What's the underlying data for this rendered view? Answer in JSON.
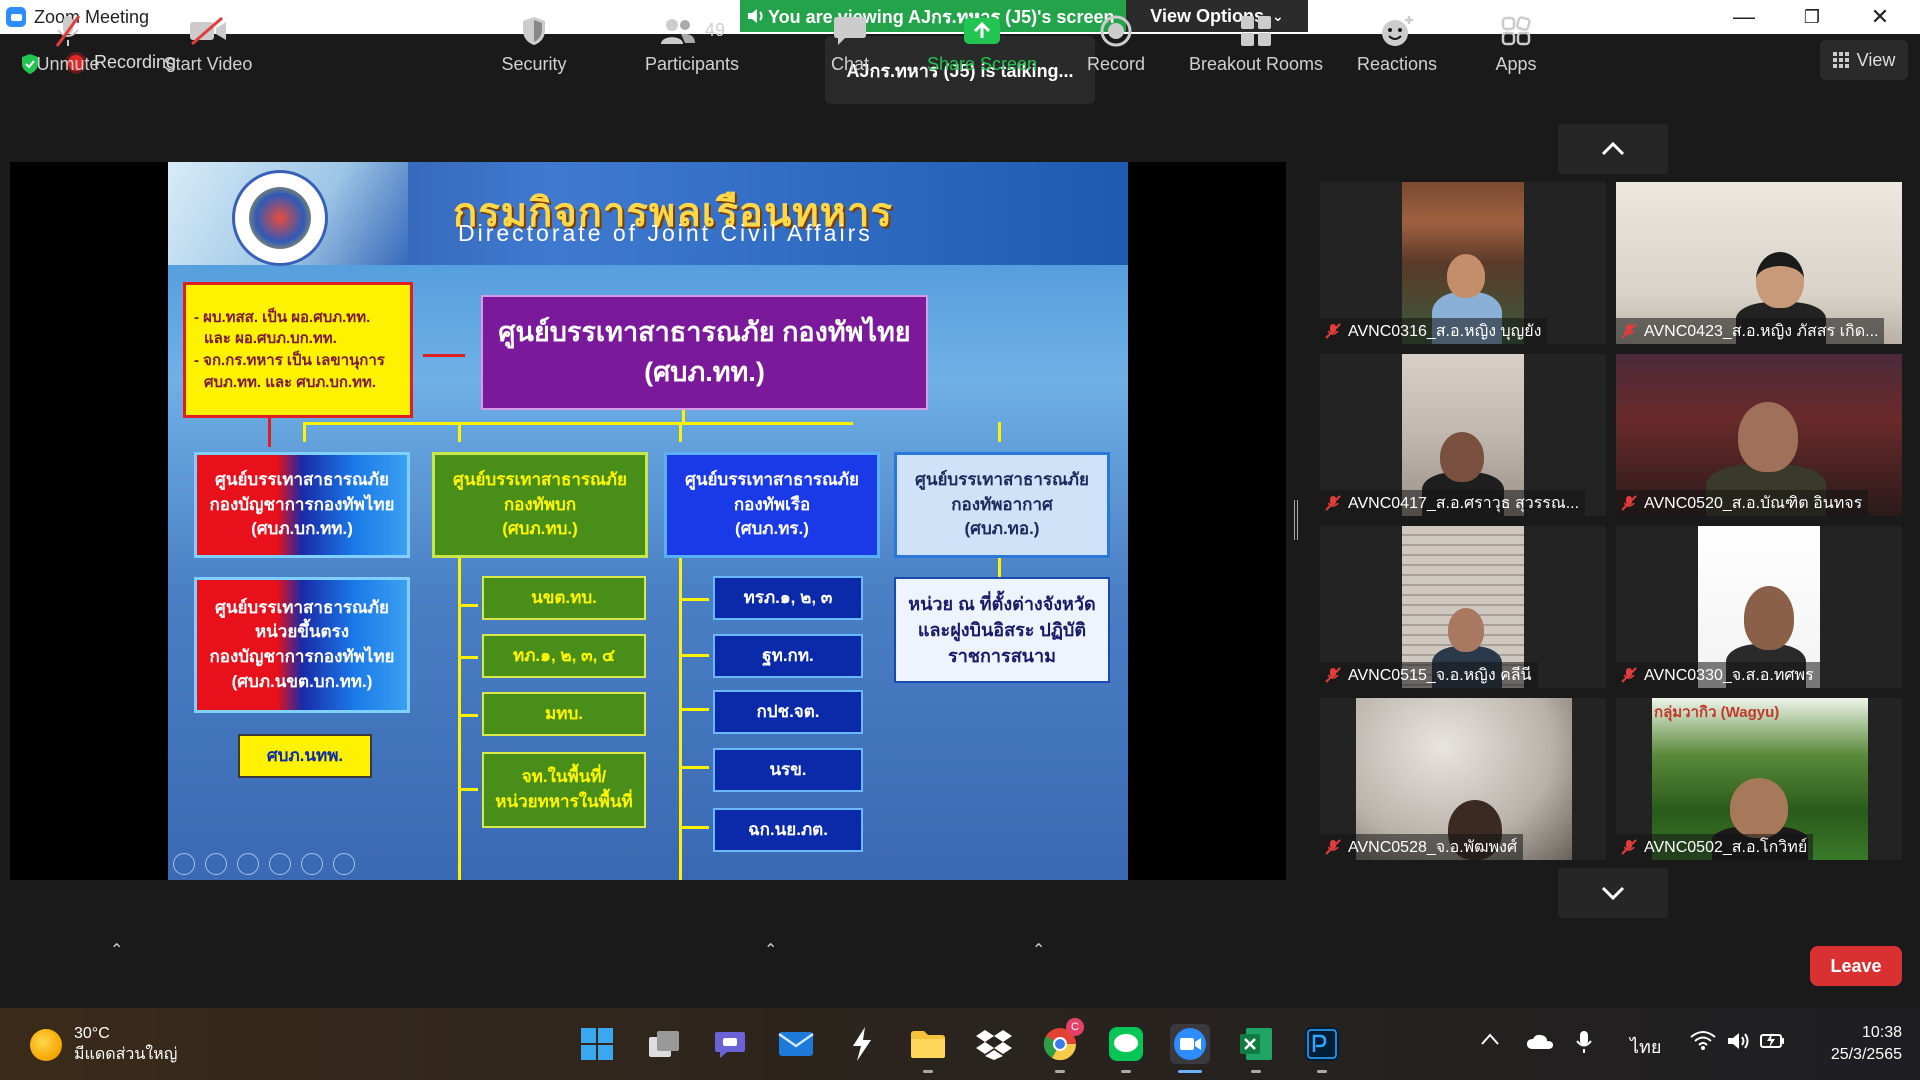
{
  "window": {
    "title": "Zoom Meeting"
  },
  "banner": {
    "viewing": "You are viewing AJกร.ทหาร (J5)'s screen",
    "view_options": "View Options"
  },
  "status": {
    "recording": "Recording",
    "talking": "AJกร.ทหาร (J5)  is talking...",
    "view": "View"
  },
  "slide": {
    "title_th": "กรมกิจการพลเรือนทหาร",
    "title_en": "Directorate of Joint Civil Affairs",
    "note_lines": [
      "- ผบ.ทสส. เป็น ผอ.ศบภ.ทท.",
      "และ ผอ.ศบภ.บก.ทท.",
      "- จก.กร.ทหาร เป็น เลขานุการ",
      "ศบภ.ทท. และ ศบภ.บก.ทท."
    ],
    "hq": {
      "line1": "ศูนย์บรรเทาสาธารณภัย กองทัพไทย",
      "line2": "(ศบภ.ทท.)"
    },
    "unit_supreme": {
      "line1": "ศูนย์บรรเทาสาธารณภัย",
      "line2": "กองบัญชาการกองทัพไทย",
      "line3": "(ศบภ.บก.ทท.)"
    },
    "unit_army": {
      "line1": "ศูนย์บรรเทาสาธารณภัย",
      "line2": "กองทัพบก",
      "line3": "(ศบภ.ทบ.)"
    },
    "unit_navy": {
      "line1": "ศูนย์บรรเทาสาธารณภัย",
      "line2": "กองทัพเรือ",
      "line3": "(ศบภ.ทร.)"
    },
    "unit_airforce": {
      "line1": "ศูนย์บรรเทาสาธารณภัย",
      "line2": "กองทัพอากาศ",
      "line3": "(ศบภ.ทอ.)"
    },
    "unit_direct": {
      "line1": "ศูนย์บรรเทาสาธารณภัย",
      "line2": "หน่วยขึ้นตรง",
      "line3": "กองบัญชาการกองทัพไทย",
      "line4": "(ศบภ.นขต.บก.ทท.)"
    },
    "sub_supreme": "ศบภ.นทพ.",
    "army_subs": [
      "นขต.ทบ.",
      "ทภ.๑, ๒, ๓, ๔",
      "มทบ."
    ],
    "army_last": {
      "line1": "จท.ในพื้นที่/",
      "line2": "หน่วยทหารในพื้นที่"
    },
    "navy_subs": [
      "ทรภ.๑, ๒, ๓",
      "ฐท.กท.",
      "กปช.จต.",
      "นรข.",
      "ฉก.นย.ภต."
    ],
    "airforce_sub": {
      "line1": "หน่วย ณ ที่ตั้งต่างจังหวัด",
      "line2": "และฝูงบินอิสระ ปฏิบัติ",
      "line3": "ราชการสนาม"
    }
  },
  "gallery": [
    {
      "name": "AVNC0316_ส.อ.หญิง บุญยัง"
    },
    {
      "name": "AVNC0423_ส.อ.หญิง ภัสสร เกิด..."
    },
    {
      "name": "AVNC0417_ส.อ.ศราวุธ สุวรรณ..."
    },
    {
      "name": "AVNC0520_ส.อ.บัณฑิต  อินทจร"
    },
    {
      "name": "AVNC0515_จ.อ.หญิง คลีนี"
    },
    {
      "name": "AVNC0330_จ.ส.อ.ทศพร"
    },
    {
      "name": "AVNC0528_จ.อ.พัฒพงศ์"
    },
    {
      "name": "AVNC0502_ส.อ.โกวิทย์",
      "overlay": "กลุ่มวากิว (Wagyu)"
    }
  ],
  "toolbar": {
    "unmute": "Unmute",
    "start_video": "Start Video",
    "security": "Security",
    "participants": "Participants",
    "participant_count": "49",
    "chat": "Chat",
    "share_screen": "Share Screen",
    "record": "Record",
    "breakout_rooms": "Breakout Rooms",
    "reactions": "Reactions",
    "apps": "Apps",
    "leave": "Leave"
  },
  "taskbar": {
    "temperature": "30°C",
    "weather": "มีแดดส่วนใหญ่",
    "language": "ไทย",
    "time": "10:38",
    "date": "25/3/2565",
    "chrome_badge": "C"
  },
  "colors": {
    "accent_green": "#23a34a",
    "leave_red": "#d93131",
    "share_green": "#23c552"
  }
}
